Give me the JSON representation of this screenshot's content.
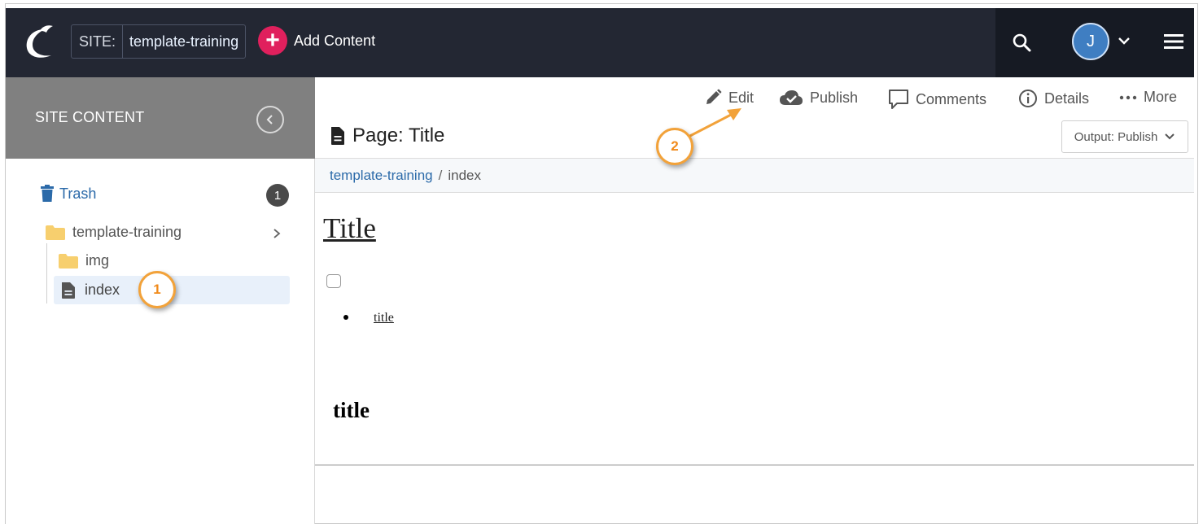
{
  "topbar": {
    "site_label": "SITE:",
    "site_name": "template-training",
    "add_content_label": "Add Content",
    "avatar_initial": "J"
  },
  "sidebar": {
    "title": "SITE CONTENT",
    "trash_label": "Trash",
    "trash_count": "1",
    "tree": {
      "root": "template-training",
      "children": [
        "img",
        "index"
      ]
    }
  },
  "toolbar": {
    "edit": "Edit",
    "publish": "Publish",
    "comments": "Comments",
    "details": "Details",
    "more": "More"
  },
  "page": {
    "title": "Page: Title",
    "output_label": "Output: Publish"
  },
  "breadcrumb": {
    "site": "template-training",
    "separator": "/",
    "current": "index"
  },
  "preview": {
    "title": "Title",
    "link": "title",
    "heading": "title"
  },
  "callouts": [
    "1",
    "2"
  ],
  "colors": {
    "topbar": "#232733",
    "accent_pink": "#e0205d",
    "link_blue": "#2b6aa9",
    "callout_orange": "#f2a23a",
    "sidebar_head": "#808080"
  }
}
